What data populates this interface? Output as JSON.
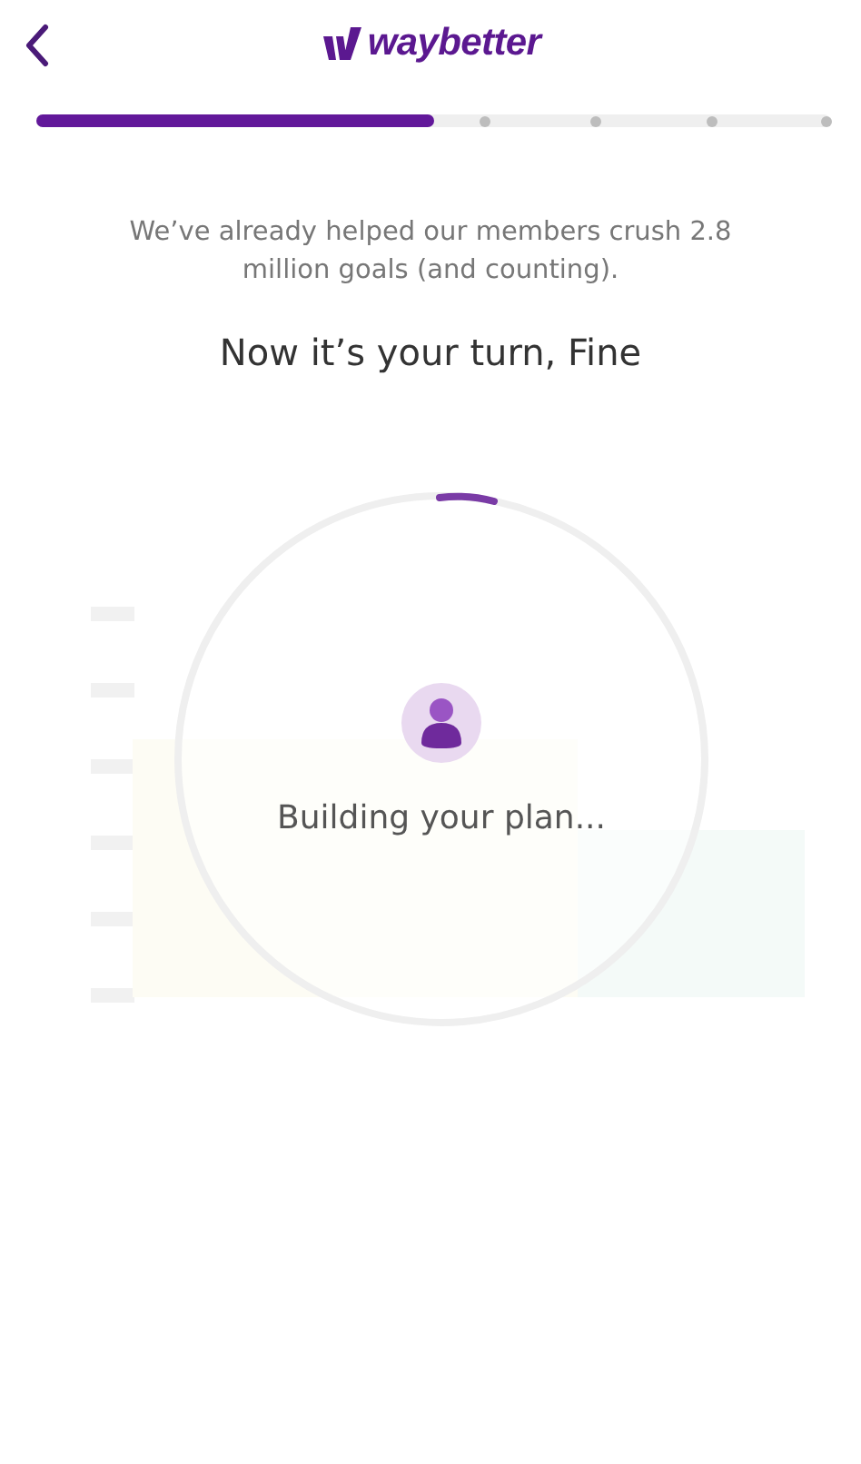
{
  "header": {
    "brand": "waybetter"
  },
  "progress": {
    "level": 0.5
  },
  "intro": "We’ve already helped our members crush 2.8 million goals (and counting).",
  "heading": "Now it’s your turn, Fine",
  "loader": {
    "status": "Building your plan..."
  }
}
